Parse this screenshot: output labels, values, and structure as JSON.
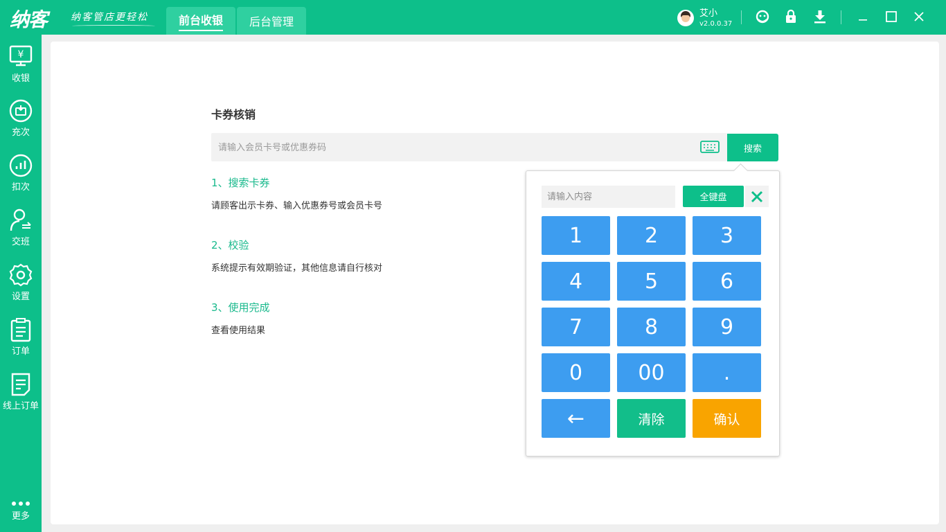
{
  "app": {
    "logo": "纳客",
    "slogan": "纳客管店更轻松",
    "nav_tabs": [
      {
        "label": "前台收银",
        "active": true
      },
      {
        "label": "后台管理",
        "active": false
      }
    ],
    "user": {
      "name": "艾小",
      "version": "v2.0.0.37"
    },
    "top_icons": [
      "support-icon",
      "lock-icon",
      "download-icon",
      "minimize-icon",
      "maximize-icon",
      "close-icon"
    ]
  },
  "sidebar": {
    "items": [
      {
        "label": "收银",
        "icon": "cashier-icon"
      },
      {
        "label": "充次",
        "icon": "recharge-icon"
      },
      {
        "label": "扣次",
        "icon": "deduct-icon"
      },
      {
        "label": "交班",
        "icon": "handover-icon"
      },
      {
        "label": "设置",
        "icon": "gear-icon"
      },
      {
        "label": "订单",
        "icon": "order-icon"
      },
      {
        "label": "线上订单",
        "icon": "online-order-icon"
      }
    ],
    "more_label": "更多"
  },
  "main": {
    "title": "卡券核销",
    "search_placeholder": "请输入会员卡号或优惠券码",
    "search_button": "搜索",
    "steps": [
      {
        "heading": "1、搜索卡券",
        "desc": "请顾客出示卡券、输入优惠券号或会员卡号"
      },
      {
        "heading": "2、校验",
        "desc": "系统提示有效期验证，其他信息请自行核对"
      },
      {
        "heading": "3、使用完成",
        "desc": "查看使用结果"
      }
    ]
  },
  "keypad": {
    "input_placeholder": "请输入内容",
    "full_keyboard_label": "全键盘",
    "keys": [
      "1",
      "2",
      "3",
      "4",
      "5",
      "6",
      "7",
      "8",
      "9",
      "0",
      "00",
      "."
    ],
    "backspace_label": "←",
    "clear_label": "清除",
    "confirm_label": "确认"
  },
  "colors": {
    "primary": "#0dbf8a",
    "key_blue": "#3d9df0",
    "confirm_orange": "#f9a400"
  }
}
